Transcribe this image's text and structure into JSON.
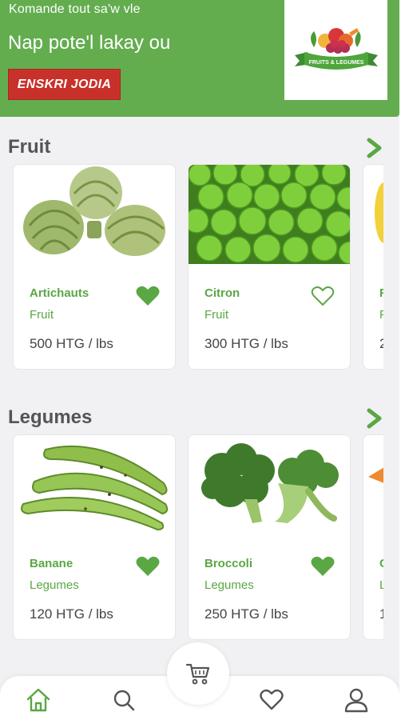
{
  "header": {
    "tagline": "Komande tout sa'w vle",
    "headline": "Nap pote'l lakay ou",
    "cta_label": "ENSKRI JODIA",
    "logo_text": "FRUITS & LEGUMES"
  },
  "sections": [
    {
      "title": "Fruit",
      "products": [
        {
          "name": "Artichauts",
          "category": "Fruit",
          "price": "500 HTG / lbs",
          "favorite": true
        },
        {
          "name": "Citron",
          "category": "Fruit",
          "price": "300 HTG / lbs",
          "favorite": false
        }
      ],
      "peek": {
        "name": "F",
        "category": "F",
        "price": "2"
      }
    },
    {
      "title": "Legumes",
      "products": [
        {
          "name": "Banane",
          "category": "Legumes",
          "price": "120 HTG / lbs",
          "favorite": true
        },
        {
          "name": "Broccoli",
          "category": "Legumes",
          "price": "250 HTG / lbs",
          "favorite": true
        }
      ],
      "peek": {
        "name": "C",
        "category": "L",
        "price": "1"
      }
    }
  ],
  "nav": {
    "items": [
      "home-icon",
      "search-icon",
      "cart-icon",
      "heart-icon",
      "user-icon"
    ],
    "active": "home"
  },
  "colors": {
    "brand_green": "#63ad4f",
    "accent_red": "#c8312a",
    "text_green": "#5aa744",
    "background": "#f1f1f3"
  }
}
